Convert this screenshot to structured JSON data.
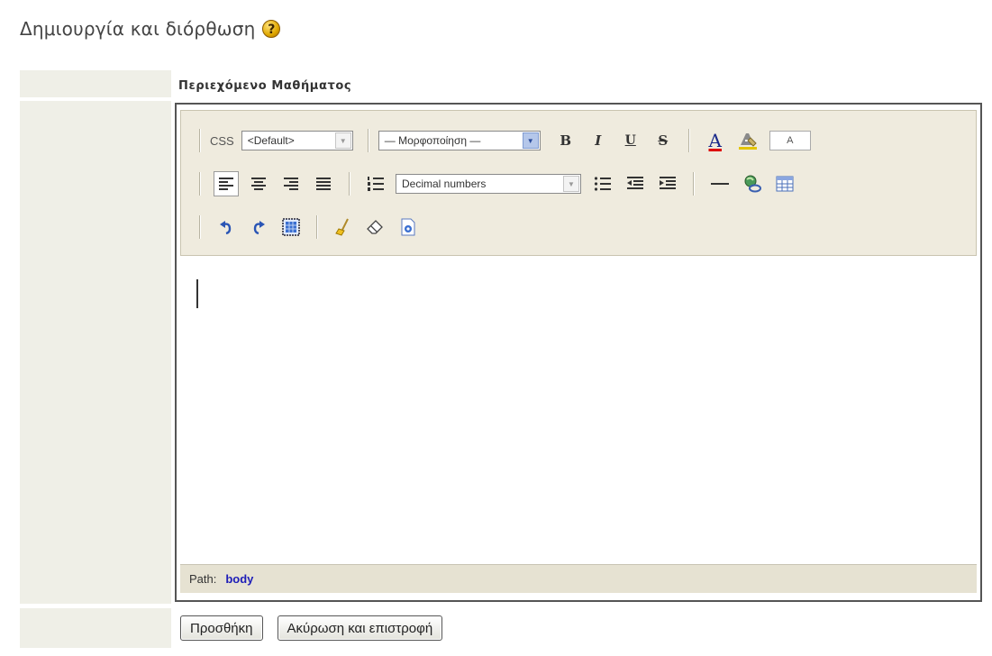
{
  "page": {
    "title": "Δημιουργία και διόρθωση",
    "help_icon_glyph": "?"
  },
  "section": {
    "label": "Περιεχόμενο Μαθήματος"
  },
  "toolbar": {
    "css_label": "CSS",
    "css_select_value": "<Default>",
    "format_select_value": "— Μορφοποίηση —",
    "bold_label": "B",
    "italic_label": "I",
    "underline_label": "U",
    "strike_label": "S",
    "forecolor_label": "A",
    "small_box_label": "A",
    "numbering_select_value": "Decimal numbers",
    "icons": [
      "align-left-icon",
      "align-center-icon",
      "align-right-icon",
      "align-justify-icon",
      "ordered-list-icon",
      "unordered-list-icon",
      "outdent-icon",
      "indent-icon",
      "horizontal-rule-icon",
      "insert-link-icon",
      "insert-table-icon",
      "undo-icon",
      "redo-icon",
      "select-all-icon",
      "cleanup-icon",
      "eraser-icon",
      "source-icon"
    ]
  },
  "status_bar": {
    "path_label": "Path:",
    "path_value": "body"
  },
  "actions": {
    "add_label": "Προσθήκη",
    "cancel_label": "Ακύρωση και επιστροφή"
  },
  "colors": {
    "toolbar_bg": "#efebde",
    "left_column_bg": "#efefe7",
    "path_link": "#1d1db8"
  }
}
